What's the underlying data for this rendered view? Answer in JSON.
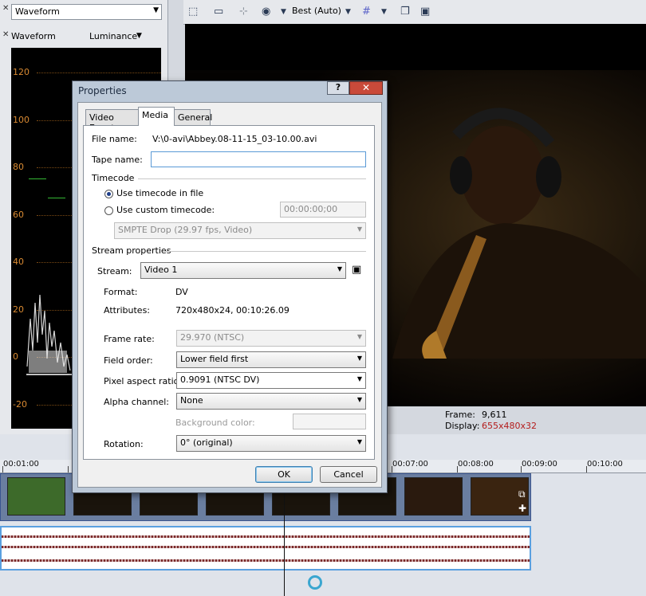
{
  "scope": {
    "mode": "Waveform",
    "label": "Waveform",
    "channel": "Luminance",
    "y_ticks": [
      "120",
      "100",
      "80",
      "60",
      "40",
      "20",
      "0",
      "-20"
    ]
  },
  "preview": {
    "quality": "Best (Auto)",
    "frame_label": "Frame:",
    "frame_value": "9,611",
    "display_label": "Display:",
    "display_value": "655x480x32",
    "display_color": "#b41c1c"
  },
  "timeline": {
    "ruler": [
      "00:01:00",
      "00:07:00",
      "00:08:00",
      "00:09:00",
      "00:10:00"
    ]
  },
  "dialog": {
    "title": "Properties",
    "help": "?",
    "close": "✕",
    "tabs": [
      "Video Event",
      "Media",
      "General"
    ],
    "active_tab": "Media",
    "file_name_label": "File name:",
    "file_name_value": "V:\\0-avi\\Abbey.08-11-15_03-10.00.avi",
    "tape_name_label": "Tape name:",
    "tape_name_value": "",
    "timecode_heading": "Timecode",
    "use_file_tc": "Use timecode in file",
    "use_custom_tc": "Use custom timecode:",
    "custom_tc_value": "00:00:00;00",
    "tc_format": "SMPTE Drop (29.97 fps, Video)",
    "stream_heading": "Stream properties",
    "stream_label": "Stream:",
    "stream_value": "Video 1",
    "format_label": "Format:",
    "format_value": "DV",
    "attributes_label": "Attributes:",
    "attributes_value": "720x480x24, 00:10:26.09",
    "frame_rate_label": "Frame rate:",
    "frame_rate_value": "29.970 (NTSC)",
    "field_order_label": "Field order:",
    "field_order_value": "Lower field first",
    "par_label": "Pixel aspect ratio:",
    "par_value": "0.9091 (NTSC DV)",
    "alpha_label": "Alpha channel:",
    "alpha_value": "None",
    "bg_color_label": "Background color:",
    "rotation_label": "Rotation:",
    "rotation_value": "0° (original)",
    "ok": "OK",
    "cancel": "Cancel"
  }
}
